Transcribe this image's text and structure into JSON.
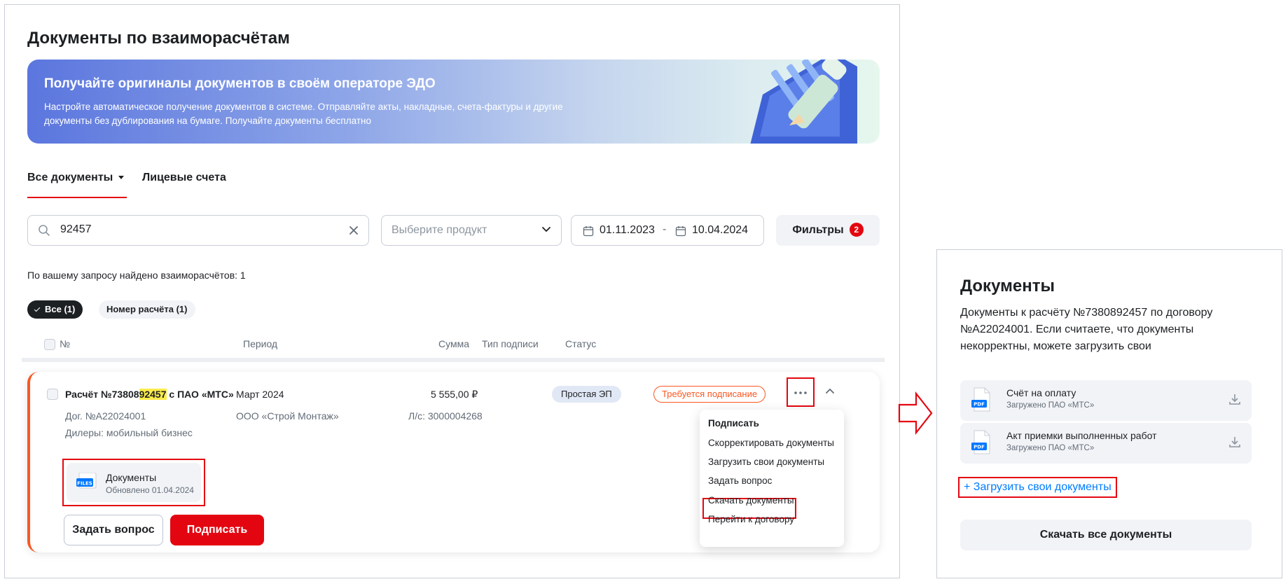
{
  "page": {
    "title": "Документы по взаиморасчётам"
  },
  "banner": {
    "title": "Получайте оригиналы документов в своём операторе ЭДО",
    "text": "Настройте автоматическое получение документов в системе. Отправляйте акты, накладные, счета-фактуры и другие документы без дублирования на бумаге. Получайте документы бесплатно"
  },
  "tabs": [
    {
      "label": "Все документы",
      "active": true
    },
    {
      "label": "Лицевые счета",
      "active": false
    }
  ],
  "search": {
    "value": "92457",
    "icon": "search-icon"
  },
  "product_select": {
    "placeholder": "Выберите продукт"
  },
  "date_range": {
    "from": "01.11.2023",
    "separator": "-",
    "to": "10.04.2024"
  },
  "filters": {
    "label": "Фильтры",
    "count": "2"
  },
  "results": {
    "found_text": "По вашему запросу найдено взаиморасчётов: 1"
  },
  "chips": [
    {
      "label": "Все (1)",
      "selected": true
    },
    {
      "label": "Номер расчёта (1)",
      "selected": false
    }
  ],
  "table": {
    "headers": {
      "number": "№",
      "period": "Период",
      "sum": "Сумма",
      "sign_type": "Тип подписи",
      "status": "Статус"
    }
  },
  "settlement": {
    "title_prefix": "Расчёт №73808",
    "title_highlight": "92457",
    "title_suffix": " с ПАО «МТС»",
    "period": "Март 2024",
    "sum": "5 555,00 ₽",
    "sign_type": "Простая ЭП",
    "status": "Требуется подписание",
    "contract": "Дог. №А22024001",
    "company": "ООО «Строй Монтаж»",
    "account": "Л/с: 3000004268",
    "segment": "Дилеры: мобильный бизнес",
    "documents": {
      "name": "Документы",
      "updated": "Обновлено 01.04.2024",
      "file_badge": "FILES"
    },
    "ask_button": "Задать вопрос",
    "sign_button": "Подписать"
  },
  "context_menu": {
    "items": [
      "Подписать",
      "Скорректировать документы",
      "Загрузить свои документы",
      "Задать вопрос",
      "Скачать документы",
      "Перейти к договору"
    ]
  },
  "side_panel": {
    "title": "Документы",
    "description": "Документы к расчёту №7380892457 по договору №А22024001. Если считаете, что документы некорректны, можете загрузить свои",
    "files": [
      {
        "name": "Счёт на оплату",
        "source": "Загружено ПАО «МТС»",
        "type": "PDF"
      },
      {
        "name": "Акт приемки выполненных работ",
        "source": "Загружено ПАО «МТС»",
        "type": "PDF"
      }
    ],
    "upload_link": "+ Загрузить свои документы",
    "download_all": "Скачать все документы"
  },
  "colors": {
    "accent": "#e30611",
    "warning": "#f95721",
    "link": "#007cff",
    "surface": "#f2f3f7",
    "text": "#1d2023"
  }
}
